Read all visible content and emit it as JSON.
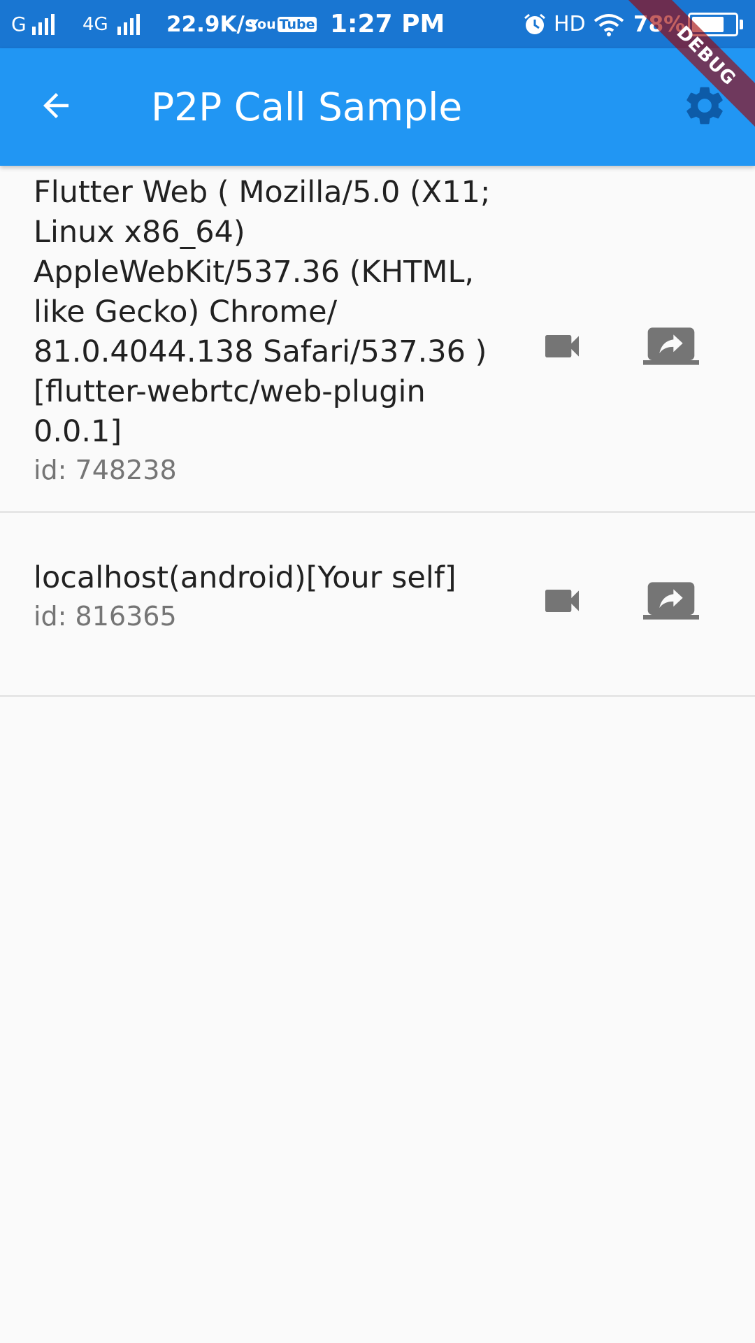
{
  "status_bar": {
    "carrier": "G",
    "network": "4G",
    "speed": "22.9K/s",
    "youtube_you": "You",
    "youtube_tube": "Tube",
    "time": "1:27 PM",
    "hd": "HD",
    "battery_pct": "78%",
    "battery_level": 0.78,
    "color": "#1976d2"
  },
  "app_bar": {
    "title": "P2P Call Sample",
    "back_icon": "arrow-back-icon",
    "settings_icon": "gear-icon",
    "color": "#2196f3"
  },
  "debug_banner": "DEBUG",
  "peers": [
    {
      "title": "Flutter Web ( Mozilla/5.0 (X11; Linux x86_64) AppleWebKit/537.36 (KHTML, like Gecko) Chrome/ 81.0.4044.138 Safari/537.36 ) [flutter-webrtc/web-plugin 0.0.1]",
      "id": "id: 748238",
      "video_icon": "videocam-icon",
      "share_icon": "screen-share-icon"
    },
    {
      "title": "localhost(android)[Your self]",
      "id": "id: 816365",
      "video_icon": "videocam-icon",
      "share_icon": "screen-share-icon"
    }
  ],
  "icon_color": "#757575"
}
